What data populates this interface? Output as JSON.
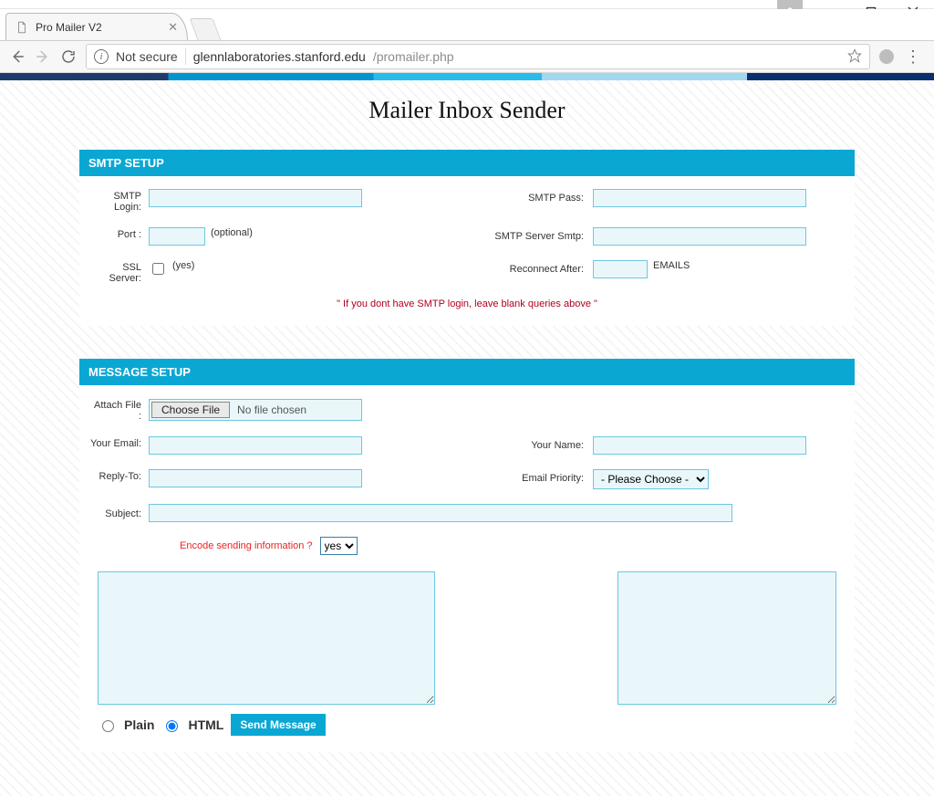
{
  "browser": {
    "tab_title": "Pro Mailer V2",
    "security_label": "Not secure",
    "url_host": "glennlaboratories.stanford.edu",
    "url_path": "/promailer.php"
  },
  "page": {
    "title": "Mailer Inbox Sender"
  },
  "smtp": {
    "header": "SMTP SETUP",
    "labels": {
      "login": "SMTP Login:",
      "pass": "SMTP Pass:",
      "port": "Port :",
      "port_hint": "(optional)",
      "server": "SMTP Server Smtp:",
      "ssl": "SSL Server:",
      "ssl_hint": "(yes)",
      "reconnect": "Reconnect After:",
      "reconnect_unit": "EMAILS"
    },
    "values": {
      "login": "",
      "pass": "",
      "port": "",
      "server": "",
      "ssl_checked": false,
      "reconnect": ""
    },
    "note": "\" If you dont have SMTP login, leave blank queries above \""
  },
  "message": {
    "header": "MESSAGE SETUP",
    "labels": {
      "attach": "Attach File :",
      "choose_file": "Choose File",
      "no_file": "No file chosen",
      "your_email": "Your Email:",
      "your_name": "Your Name:",
      "reply_to": "Reply-To:",
      "priority": "Email Priority:",
      "subject": "Subject:",
      "encode_q": "Encode sending information ?",
      "format_plain": "Plain",
      "format_html": "HTML",
      "send": "Send Message"
    },
    "values": {
      "your_email": "",
      "your_name": "",
      "reply_to": "",
      "subject": "",
      "encode_selected": "yes",
      "priority_selected": "- Please Choose -",
      "body_left": "",
      "body_right": "",
      "format": "HTML"
    },
    "priority_options": [
      "- Please Choose -"
    ],
    "encode_options": [
      "yes"
    ]
  }
}
